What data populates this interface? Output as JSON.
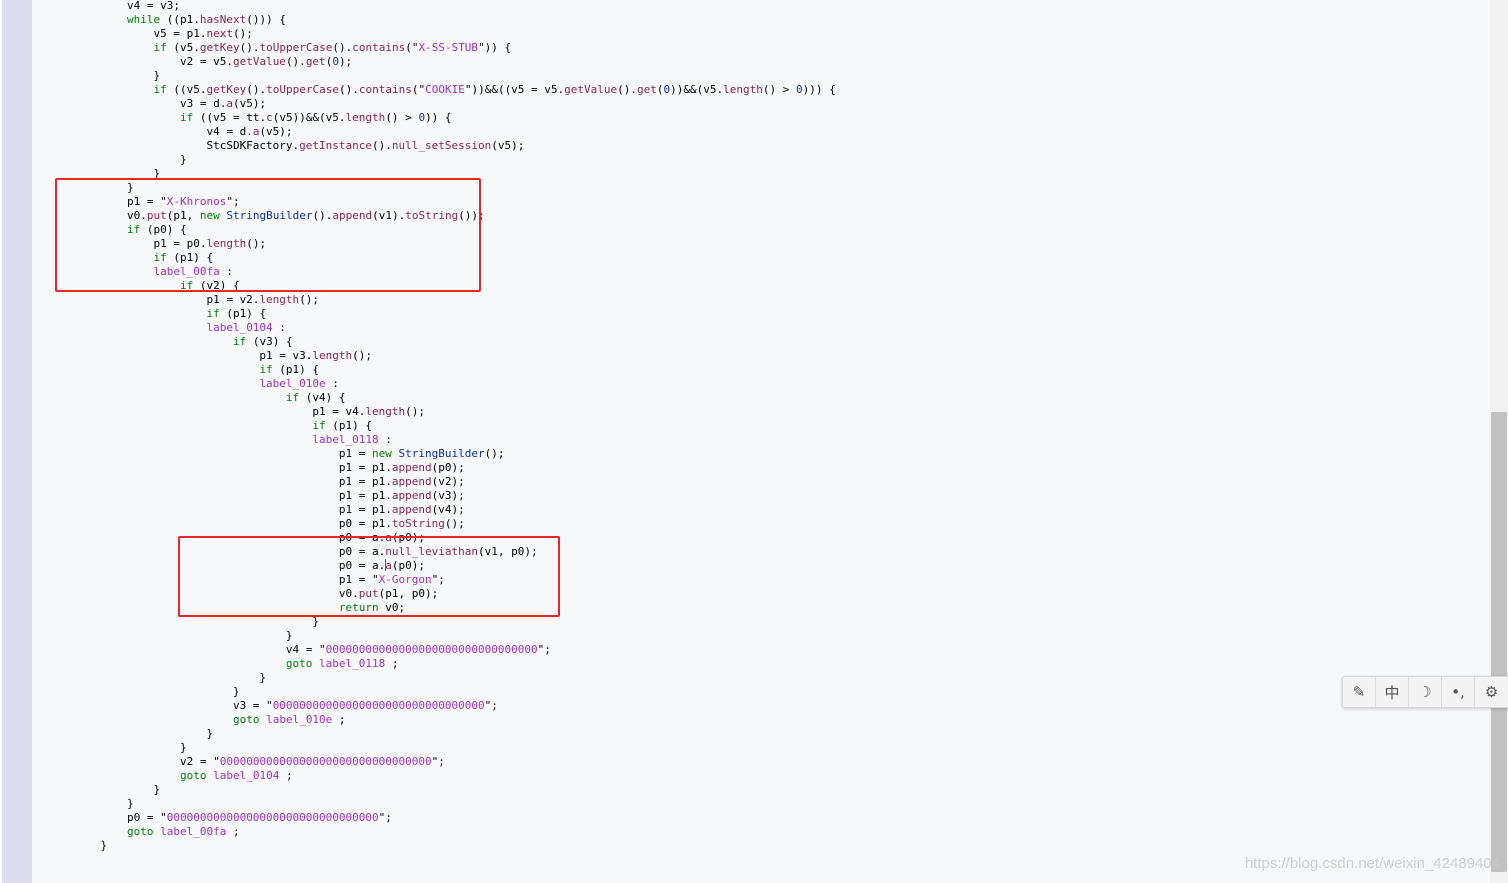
{
  "code": {
    "lines": [
      [
        {
          "t": "        v4 = v3;"
        }
      ],
      [
        {
          "t": "        "
        },
        {
          "t": "while",
          "c": "kw"
        },
        {
          "t": " ((p1."
        },
        {
          "t": "hasNext",
          "c": "m"
        },
        {
          "t": "())) {"
        }
      ],
      [
        {
          "t": "            v5 = p1."
        },
        {
          "t": "next",
          "c": "m"
        },
        {
          "t": "();"
        }
      ],
      [
        {
          "t": "            "
        },
        {
          "t": "if",
          "c": "kw"
        },
        {
          "t": " (v5."
        },
        {
          "t": "getKey",
          "c": "m"
        },
        {
          "t": "()."
        },
        {
          "t": "toUpperCase",
          "c": "m"
        },
        {
          "t": "()."
        },
        {
          "t": "contains",
          "c": "m"
        },
        {
          "t": "(\""
        },
        {
          "t": "X-SS-STUB",
          "c": "s"
        },
        {
          "t": "\")) {"
        }
      ],
      [
        {
          "t": "                v2 = v5."
        },
        {
          "t": "getValue",
          "c": "m"
        },
        {
          "t": "()."
        },
        {
          "t": "get",
          "c": "m"
        },
        {
          "t": "("
        },
        {
          "t": "0",
          "c": "n"
        },
        {
          "t": ");"
        }
      ],
      [
        {
          "t": "            }"
        }
      ],
      [
        {
          "t": "            "
        },
        {
          "t": "if",
          "c": "kw"
        },
        {
          "t": " ((v5."
        },
        {
          "t": "getKey",
          "c": "m"
        },
        {
          "t": "()."
        },
        {
          "t": "toUpperCase",
          "c": "m"
        },
        {
          "t": "()."
        },
        {
          "t": "contains",
          "c": "m"
        },
        {
          "t": "(\""
        },
        {
          "t": "COOKIE",
          "c": "s"
        },
        {
          "t": "\"))&&((v5 = v5."
        },
        {
          "t": "getValue",
          "c": "m"
        },
        {
          "t": "()."
        },
        {
          "t": "get",
          "c": "m"
        },
        {
          "t": "("
        },
        {
          "t": "0",
          "c": "n"
        },
        {
          "t": "))&&(v5."
        },
        {
          "t": "length",
          "c": "m"
        },
        {
          "t": "() > "
        },
        {
          "t": "0",
          "c": "n"
        },
        {
          "t": "))) {"
        }
      ],
      [
        {
          "t": "                v3 = d."
        },
        {
          "t": "a",
          "c": "m"
        },
        {
          "t": "(v5);"
        }
      ],
      [
        {
          "t": "                "
        },
        {
          "t": "if",
          "c": "kw"
        },
        {
          "t": " ((v5 = tt."
        },
        {
          "t": "c",
          "c": "m"
        },
        {
          "t": "(v5))&&(v5."
        },
        {
          "t": "length",
          "c": "m"
        },
        {
          "t": "() > "
        },
        {
          "t": "0",
          "c": "n"
        },
        {
          "t": ")) {"
        }
      ],
      [
        {
          "t": "                    v4 = d."
        },
        {
          "t": "a",
          "c": "m"
        },
        {
          "t": "(v5);"
        }
      ],
      [
        {
          "t": "                    StcSDKFactory."
        },
        {
          "t": "getInstance",
          "c": "m"
        },
        {
          "t": "()."
        },
        {
          "t": "null_setSession",
          "c": "m"
        },
        {
          "t": "(v5);"
        }
      ],
      [
        {
          "t": "                }"
        }
      ],
      [
        {
          "t": "            }"
        }
      ],
      [
        {
          "t": "        }"
        }
      ],
      [
        {
          "t": "        p1 = \""
        },
        {
          "t": "X-Khronos",
          "c": "s"
        },
        {
          "t": "\";"
        }
      ],
      [
        {
          "t": "        v0."
        },
        {
          "t": "put",
          "c": "m"
        },
        {
          "t": "(p1, "
        },
        {
          "t": "new",
          "c": "kw"
        },
        {
          "t": " "
        },
        {
          "t": "StringBuilder",
          "c": "t"
        },
        {
          "t": "()."
        },
        {
          "t": "append",
          "c": "m"
        },
        {
          "t": "(v1)."
        },
        {
          "t": "toString",
          "c": "m"
        },
        {
          "t": "());"
        }
      ],
      [
        {
          "t": "        "
        },
        {
          "t": "if",
          "c": "kw"
        },
        {
          "t": " (p0) {"
        }
      ],
      [
        {
          "t": "            p1 = p0."
        },
        {
          "t": "length",
          "c": "m"
        },
        {
          "t": "();"
        }
      ],
      [
        {
          "t": "            "
        },
        {
          "t": "if",
          "c": "kw"
        },
        {
          "t": " (p1) {"
        }
      ],
      [
        {
          "t": "            "
        },
        {
          "t": "label_00fa",
          "c": "lbl"
        },
        {
          "t": " :"
        }
      ],
      [
        {
          "t": "                "
        },
        {
          "t": "if",
          "c": "kw"
        },
        {
          "t": " (v2) {"
        }
      ],
      [
        {
          "t": "                    p1 = v2."
        },
        {
          "t": "length",
          "c": "m"
        },
        {
          "t": "();"
        }
      ],
      [
        {
          "t": "                    "
        },
        {
          "t": "if",
          "c": "kw"
        },
        {
          "t": " (p1) {"
        }
      ],
      [
        {
          "t": "                    "
        },
        {
          "t": "label_0104",
          "c": "lbl"
        },
        {
          "t": " :"
        }
      ],
      [
        {
          "t": "                        "
        },
        {
          "t": "if",
          "c": "kw"
        },
        {
          "t": " (v3) {"
        }
      ],
      [
        {
          "t": "                            p1 = v3."
        },
        {
          "t": "length",
          "c": "m"
        },
        {
          "t": "();"
        }
      ],
      [
        {
          "t": "                            "
        },
        {
          "t": "if",
          "c": "kw"
        },
        {
          "t": " (p1) {"
        }
      ],
      [
        {
          "t": "                            "
        },
        {
          "t": "label_010e",
          "c": "lbl"
        },
        {
          "t": " :"
        }
      ],
      [
        {
          "t": "                                "
        },
        {
          "t": "if",
          "c": "kw"
        },
        {
          "t": " (v4) {"
        }
      ],
      [
        {
          "t": "                                    p1 = v4."
        },
        {
          "t": "length",
          "c": "m"
        },
        {
          "t": "();"
        }
      ],
      [
        {
          "t": "                                    "
        },
        {
          "t": "if",
          "c": "kw"
        },
        {
          "t": " (p1) {"
        }
      ],
      [
        {
          "t": "                                    "
        },
        {
          "t": "label_0118",
          "c": "lbl"
        },
        {
          "t": " :"
        }
      ],
      [
        {
          "t": "                                        p1 = "
        },
        {
          "t": "new",
          "c": "kw"
        },
        {
          "t": " "
        },
        {
          "t": "StringBuilder",
          "c": "t"
        },
        {
          "t": "();"
        }
      ],
      [
        {
          "t": "                                        p1 = p1."
        },
        {
          "t": "append",
          "c": "m"
        },
        {
          "t": "(p0);"
        }
      ],
      [
        {
          "t": "                                        p1 = p1."
        },
        {
          "t": "append",
          "c": "m"
        },
        {
          "t": "(v2);"
        }
      ],
      [
        {
          "t": "                                        p1 = p1."
        },
        {
          "t": "append",
          "c": "m"
        },
        {
          "t": "(v3);"
        }
      ],
      [
        {
          "t": "                                        p1 = p1."
        },
        {
          "t": "append",
          "c": "m"
        },
        {
          "t": "(v4);"
        }
      ],
      [
        {
          "t": "                                        p0 = p1."
        },
        {
          "t": "toString",
          "c": "m"
        },
        {
          "t": "();"
        }
      ],
      [
        {
          "t": "                                        p0 = a."
        },
        {
          "t": "a",
          "c": "m"
        },
        {
          "t": "(p0);"
        }
      ],
      [
        {
          "t": "                                        p0 = a."
        },
        {
          "t": "null_leviathan",
          "c": "m"
        },
        {
          "t": "(v1, p0);"
        }
      ],
      [
        {
          "t": "                                        p0 = a."
        },
        {
          "t": "caret",
          "c": "caret"
        },
        {
          "t": "a",
          "c": "m"
        },
        {
          "t": "(p0);"
        }
      ],
      [
        {
          "t": "                                        p1 = \""
        },
        {
          "t": "X-Gorgon",
          "c": "s"
        },
        {
          "t": "\";"
        }
      ],
      [
        {
          "t": "                                        v0."
        },
        {
          "t": "put",
          "c": "m"
        },
        {
          "t": "(p1, p0);"
        }
      ],
      [
        {
          "t": "                                        "
        },
        {
          "t": "return",
          "c": "kw"
        },
        {
          "t": " v0;"
        }
      ],
      [
        {
          "t": "                                    }"
        }
      ],
      [
        {
          "t": "                                }"
        }
      ],
      [
        {
          "t": "                                v4 = \""
        },
        {
          "t": "00000000000000000000000000000000",
          "c": "s"
        },
        {
          "t": "\";"
        }
      ],
      [
        {
          "t": "                                "
        },
        {
          "t": "goto",
          "c": "kw"
        },
        {
          "t": " "
        },
        {
          "t": "label_0118",
          "c": "lbl"
        },
        {
          "t": " ;"
        }
      ],
      [
        {
          "t": "                            }"
        }
      ],
      [
        {
          "t": "                        }"
        }
      ],
      [
        {
          "t": "                        v3 = \""
        },
        {
          "t": "00000000000000000000000000000000",
          "c": "s"
        },
        {
          "t": "\";"
        }
      ],
      [
        {
          "t": "                        "
        },
        {
          "t": "goto",
          "c": "kw"
        },
        {
          "t": " "
        },
        {
          "t": "label_010e",
          "c": "lbl"
        },
        {
          "t": " ;"
        }
      ],
      [
        {
          "t": "                    }"
        }
      ],
      [
        {
          "t": "                }"
        }
      ],
      [
        {
          "t": "                v2 = \""
        },
        {
          "t": "00000000000000000000000000000000",
          "c": "s"
        },
        {
          "t": "\";"
        }
      ],
      [
        {
          "t": "                "
        },
        {
          "t": "goto",
          "c": "kw"
        },
        {
          "t": " "
        },
        {
          "t": "label_0104",
          "c": "lbl"
        },
        {
          "t": " ;"
        }
      ],
      [
        {
          "t": "            }"
        }
      ],
      [
        {
          "t": "        }"
        }
      ],
      [
        {
          "t": "        p0 = \""
        },
        {
          "t": "00000000000000000000000000000000",
          "c": "s"
        },
        {
          "t": "\";"
        }
      ],
      [
        {
          "t": "        "
        },
        {
          "t": "goto",
          "c": "kw"
        },
        {
          "t": " "
        },
        {
          "t": "label_00fa",
          "c": "lbl"
        },
        {
          "t": " ;"
        }
      ],
      [
        {
          "t": "    }"
        }
      ]
    ]
  },
  "toolbar": {
    "buttons": [
      {
        "name": "edit-icon-button",
        "glyph": "✎"
      },
      {
        "name": "language-zh-button",
        "glyph": "中"
      },
      {
        "name": "night-mode-button",
        "glyph": "☽"
      },
      {
        "name": "punctuation-button",
        "glyph": "•,"
      },
      {
        "name": "settings-button",
        "glyph": "⚙"
      }
    ]
  },
  "watermark": {
    "text": "https://blog.csdn.net/weixin_42489404"
  },
  "colors": {
    "highlight_box": "#e8262c",
    "keyword": "#008000",
    "string": "#a030c0",
    "method": "#8b2252",
    "type": "#0a30b0"
  }
}
